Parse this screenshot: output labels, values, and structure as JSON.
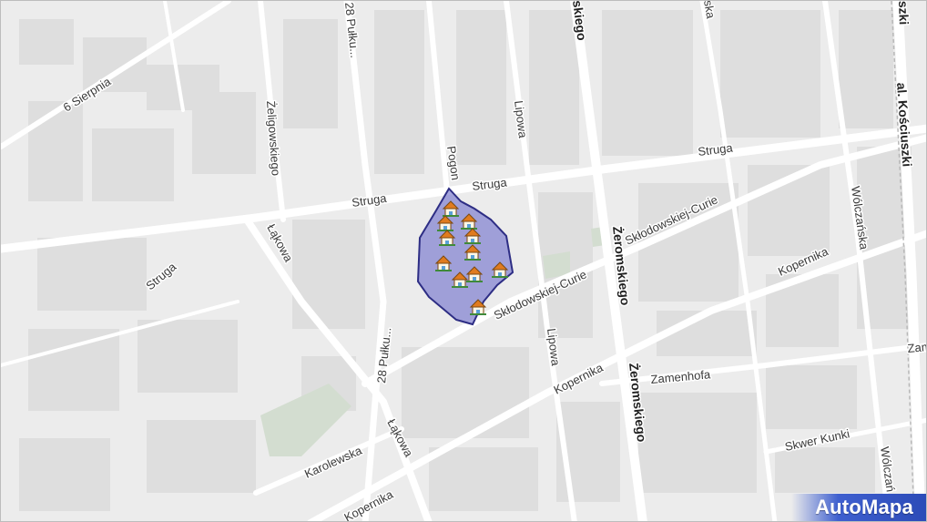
{
  "map": {
    "brand": "AutoMapa",
    "colors": {
      "background": "#ececec",
      "road": "#ffffff",
      "block": "#dcdcdc",
      "park": "#cfdccb",
      "area_fill": "#7f7fd0",
      "area_stroke": "#2d2d84"
    },
    "streets": {
      "sierpnia": "6 Sierpnia",
      "p28_top": "28 Pułku...",
      "zeligowskiego": "Żeligowskiego",
      "struga_a": "Struga",
      "struga_b": "Struga",
      "struga_c": "Struga",
      "struga_d": "Struga",
      "lakowa_a": "Łąkowa",
      "lakowa_b": "Łąkowa",
      "pogon": "Pogon",
      "lipowa_a": "Lipowa",
      "lipowa_b": "Lipowa",
      "zerom_top": "skiego",
      "zerom_a": "Żeromskiego",
      "zerom_b": "Żeromskiego",
      "skl_a": "Skłodowskiej-Curie",
      "skl_b": "Skłodowskiej-Curie",
      "kopernika_a": "Kopernika",
      "kopernika_b": "Kopernika",
      "kopernika_c": "Kopernika",
      "p28_bottom": "28 Pułku...",
      "ska_top": "ska",
      "koscius_top": "szki",
      "koscius": "al. Kościuszki",
      "wolcz_a": "Wólczańska",
      "wolcz_b": "Wólczań",
      "zam": "Zam",
      "zamenhofa": "Zamenhofa",
      "skwer": "Skwer Kunki",
      "karolewska": "Karolewska"
    },
    "markers_icon": "house-icon",
    "marker_count": 11
  }
}
